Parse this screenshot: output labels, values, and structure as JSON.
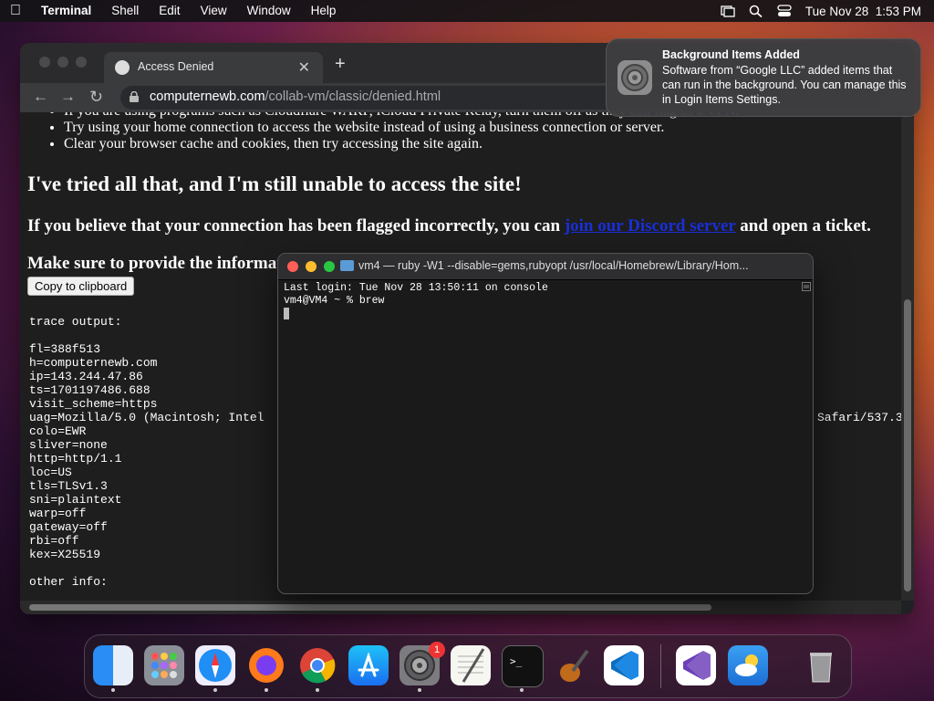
{
  "menubar": {
    "app": "Terminal",
    "items": [
      "Shell",
      "Edit",
      "View",
      "Window",
      "Help"
    ],
    "datetime": "Tue Nov 28  1:53 PM"
  },
  "browser": {
    "tab_title": "Access Denied",
    "url_host": "computernewb.com",
    "url_path": "/collab-vm/classic/denied.html",
    "page": {
      "bullet_partial": "If you are using programs such as Cloudflare WARP, iCloud Private Relay, turn them off as they can flag as a VPN.",
      "bullets": [
        "Try using your home connection to access the website instead of using a business connection or server.",
        "Clear your browser cache and cookies, then try accessing the site again."
      ],
      "heading": "I've tried all that, and I'm still unable to access the site!",
      "discord_pre": "If you believe that your connection has been flagged incorrectly, you can ",
      "discord_link": "join our Discord server",
      "discord_post": " and open a ticket.",
      "make_sure": "Make sure to provide the informat",
      "copy_button": "Copy to clipboard",
      "trace_text": "trace output:\n\nfl=388f513\nh=computernewb.com\nip=143.244.47.86\nts=1701197486.688\nvisit_scheme=https\nuag=Mozilla/5.0 (Macintosh; Intel\ncolo=EWR\nsliver=none\nhttp=http/1.1\nloc=US\ntls=TLSv1.3\nsni=plaintext\nwarp=off\ngateway=off\nrbi=off\nkex=X25519\n\nother info:",
      "uag_tail": "Safari/537.3"
    }
  },
  "notification": {
    "title": "Background Items Added",
    "body": "Software from “Google LLC” added items that can run in the background. You can manage this in Login Items Settings."
  },
  "terminal": {
    "title": "vm4 — ruby -W1 --disable=gems,rubyopt /usr/local/Homebrew/Library/Hom...",
    "line1": "Last login: Tue Nov 28 13:50:11 on console",
    "line2": "vm4@VM4 ~ % brew"
  },
  "dock": {
    "apps": [
      "finder-icon",
      "launchpad-icon",
      "safari-icon",
      "firefox-icon",
      "chrome-icon",
      "app-store-icon",
      "system-settings-icon",
      "textedit-icon",
      "terminal-icon",
      "garageband-icon",
      "vscode-icon",
      "visual-studio-icon",
      "weather-icon",
      "trash-icon"
    ],
    "settings_badge": "1"
  }
}
